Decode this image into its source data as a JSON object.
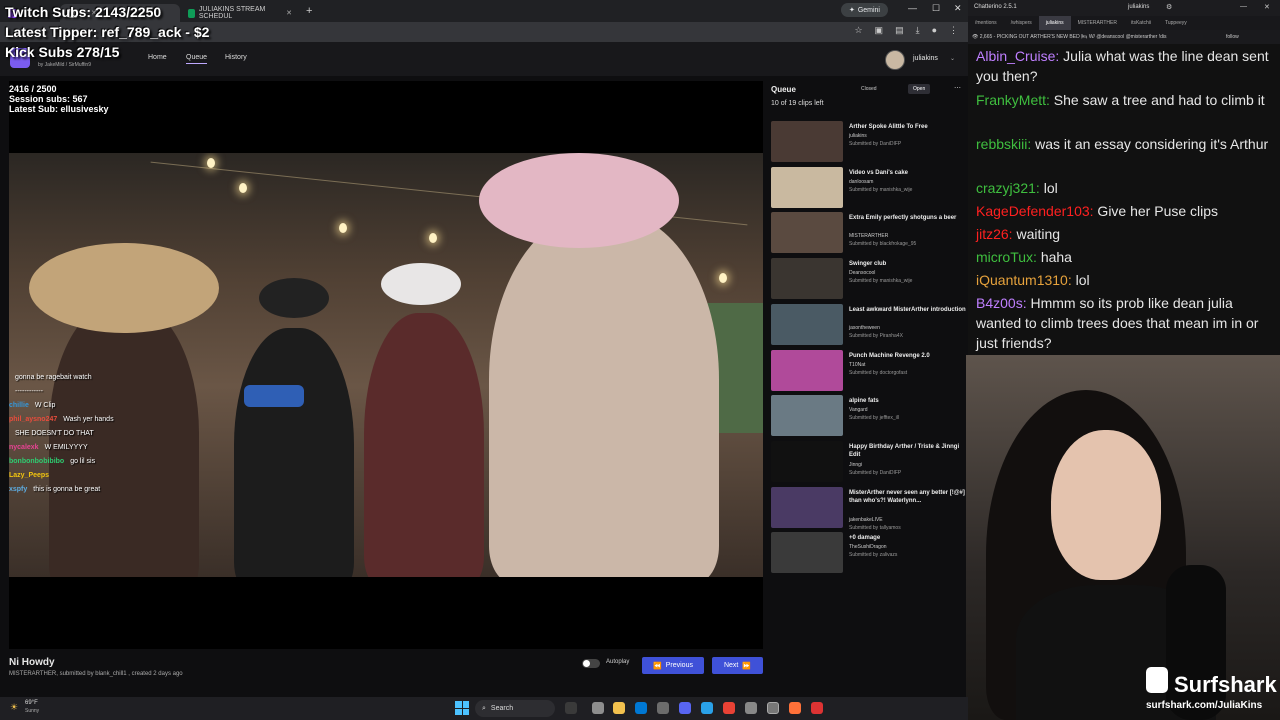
{
  "browser": {
    "tabs": [
      {
        "label": "",
        "color": "#9146ff",
        "active": false
      },
      {
        "label": "",
        "color": "#ffffff",
        "active": true
      },
      {
        "label": "JULIAKINS STREAM SCHEDUL",
        "color": "#0f9d58",
        "active": false
      }
    ],
    "gemini_label": "Gemini"
  },
  "stream_overlay": {
    "twitch_subs": "Twitch Subs: 2143/2250",
    "latest_tipper": "Latest Tipper: ref_789_ack - $2",
    "kick_subs": "Kick Subs 278/15"
  },
  "app": {
    "byline_prefix": "by",
    "byline_users": "JakeMild / SirMuffin9",
    "nav": {
      "home": "Home",
      "queue": "Queue",
      "history": "History"
    },
    "username": "juliakins",
    "player_overlay": {
      "sub_goal": "2416 / 2500",
      "session_subs": "Session subs: 567",
      "latest_sub": "Latest Sub: ellusivesky"
    },
    "player_chat": [
      {
        "user": "",
        "text": "gonna be ragebait watch",
        "color": "#9b59b6"
      },
      {
        "user": "",
        "text": "------------",
        "color": "#e67e22"
      },
      {
        "user": "chillie",
        "text": "W Clip",
        "color": "#3498db"
      },
      {
        "user": "phil_aysno247",
        "text": "Wash yer hands",
        "color": "#e74c3c"
      },
      {
        "user": "",
        "text": "SHE DOESN'T DO THAT",
        "color": "#27ae60"
      },
      {
        "user": "nycalexk",
        "text": "W EMILYYYY",
        "color": "#e84393"
      },
      {
        "user": "bonbonbobibibo",
        "text": "go lil sis",
        "color": "#2ecc71"
      },
      {
        "user": "Lazy_Peeps",
        "text": "",
        "color": "#f1c40f"
      },
      {
        "user": "xspfy",
        "text": "this is gonna be great",
        "color": "#5dade2"
      }
    ],
    "clip": {
      "title": "Ni Howdy",
      "channel": "MISTERARTHER",
      "meta": ", submitted by blank_chill1 , created 2 days ago"
    },
    "autoplay_label": "Autoplay",
    "prev_label": "Previous",
    "next_label": "Next",
    "queue": {
      "title": "Queue",
      "count": "10 of 19 clips left",
      "closed_label": "Closed",
      "open_label": "Open",
      "items": [
        {
          "title": "Arther Spoke Alittle To Free",
          "channel": "juliakins",
          "submitted": "Submitted by DaniDIFP",
          "thumb": "#4a3a34"
        },
        {
          "title": "Video vs Dani's cake",
          "channel": "danloosam",
          "submitted": "Submitted by manishka_wije",
          "thumb": "#c9b9a0"
        },
        {
          "title": "Extra Emily perfectly shotguns a beer",
          "channel": "MISTERARTHER",
          "submitted": "Submitted by blackfrokage_95",
          "thumb": "#5a4a40"
        },
        {
          "title": "Swinger club",
          "channel": "Deansocool",
          "submitted": "Submitted by manishka_wije",
          "thumb": "#3a3530"
        },
        {
          "title": "Least awkward MisterArther introduction",
          "channel": "jasontheween",
          "submitted": "Submitted by Piranha4X",
          "thumb": "#4a5a64"
        },
        {
          "title": "Punch Machine Revenge 2.0",
          "channel": "T10Nat",
          "submitted": "Submitted by doctorgofast",
          "thumb": "#b04a9a"
        },
        {
          "title": "alpine fats",
          "channel": "Vangard",
          "submitted": "Submitted by jefftex_ill",
          "thumb": "#6a7a84"
        },
        {
          "title": "Happy Birthday Arther / Triste & Jinngi Edit",
          "channel": "Jinngi",
          "submitted": "Submitted by DaniDIFP",
          "thumb": "#111111"
        },
        {
          "title": "MisterArther never seen any better [!@#] than who's?! Waterlynn...",
          "channel": "jakenbakeLIVE",
          "submitted": "Submitted by tallyamos",
          "thumb": "#4a3a64"
        },
        {
          "title": "+0 damage",
          "channel": "TheSushiDragon",
          "submitted": "Submitted by zalivazs",
          "thumb": "#3a3a3a"
        }
      ]
    }
  },
  "chatterino": {
    "title": "Chatterino 2.5.1",
    "user": "juliakins",
    "tabs": [
      "/mentions",
      "/whispers",
      "juliakins",
      "MISTERARTHER",
      "itsKatchii",
      "Tuppeeyy"
    ],
    "header_text": "👁 2,665 - PICKING OUT ARTHER'S NEW BED 🛏 W/ @deanscool @misterarther !dis",
    "follow_label": "follow",
    "messages": [
      {
        "user": "Albin_Cruise:",
        "text": " Julia what was the line dean sent you then?",
        "color": "#bf7fff"
      },
      {
        "user": "FrankyMett:",
        "text": " She saw a tree and had to climb it",
        "color": "#3fbf3f"
      },
      {
        "user": "rebbskiii:",
        "text": " was it an essay considering it's Arthur",
        "color": "#3fbf3f"
      },
      {
        "user": "crazyj321:",
        "text": " lol",
        "color": "#3fbf3f"
      },
      {
        "user": "KageDefender103:",
        "text": " Give her Puse clips",
        "color": "#ff2020"
      },
      {
        "user": "jitz26:",
        "text": " waiting",
        "color": "#ff2020"
      },
      {
        "user": "microTux:",
        "text": " haha",
        "color": "#3fbf3f"
      },
      {
        "user": "iQuantum1310:",
        "text": " lol",
        "color": "#e6a23c"
      },
      {
        "user": "B4z00s:",
        "text": " Hmmm so its prob like dean julia wanted to climb trees does that mean im in or just friends?",
        "color": "#bf7fff"
      }
    ]
  },
  "sponsor": {
    "brand": "Surfshark",
    "url": "surfshark.com/JuliaKins"
  },
  "taskbar": {
    "temp": "69°F",
    "condition": "Sunny",
    "search_label": "Search"
  }
}
